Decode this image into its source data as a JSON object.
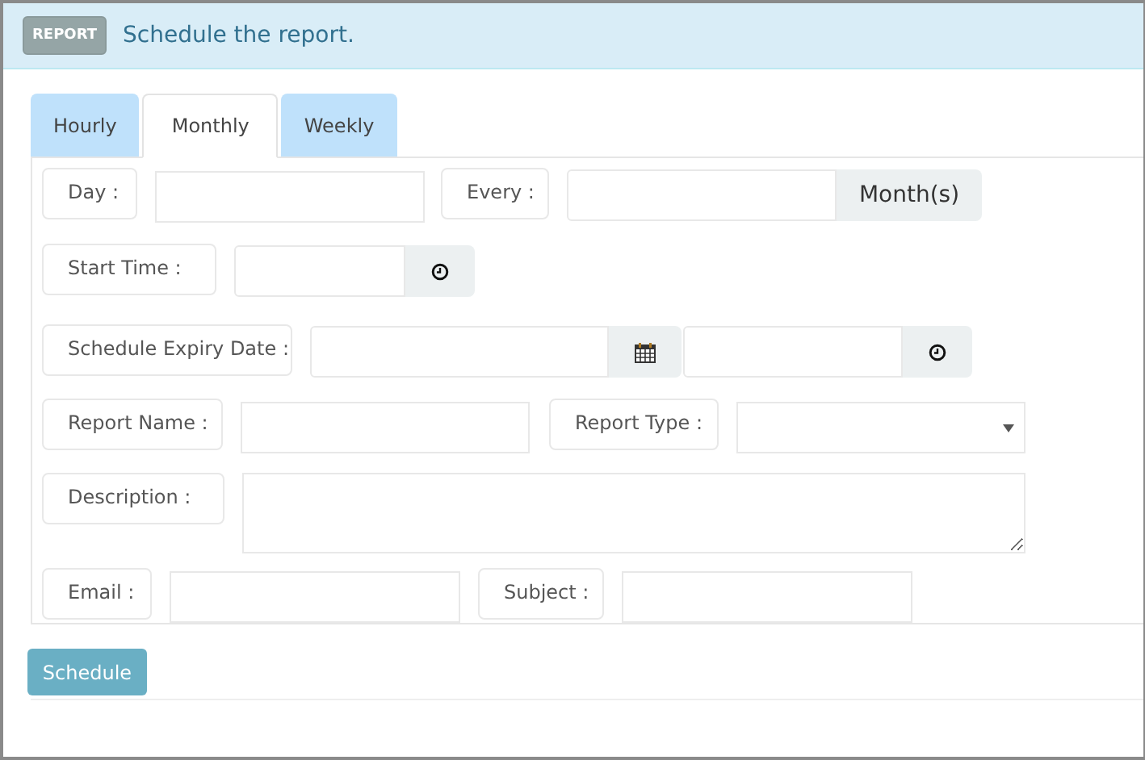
{
  "header": {
    "badge": "REPORT",
    "title": "Schedule the report."
  },
  "tabs": [
    {
      "label": "Hourly",
      "selected": false
    },
    {
      "label": "Monthly",
      "selected": true
    },
    {
      "label": "Weekly",
      "selected": false
    }
  ],
  "form_rows": [
    [
      {
        "kind": "label",
        "text": "Day :"
      },
      {
        "kind": "input"
      },
      {
        "kind": "label",
        "text": "Every :"
      },
      {
        "kind": "unit-input",
        "unit": "Month(s)"
      }
    ],
    [
      {
        "kind": "label",
        "text": "Start Time :"
      },
      {
        "kind": "time-input"
      }
    ],
    [
      {
        "kind": "label",
        "text": "Schedule Expiry Date :"
      },
      {
        "kind": "date-input"
      },
      {
        "kind": "time-input"
      }
    ],
    [
      {
        "kind": "label",
        "text": "Report Name :"
      },
      {
        "kind": "input"
      },
      {
        "kind": "label",
        "text": "Report Type :"
      },
      {
        "kind": "select"
      }
    ],
    [
      {
        "kind": "label",
        "text": "Description :"
      },
      {
        "kind": "textarea"
      }
    ],
    [
      {
        "kind": "label",
        "text": "Email :"
      },
      {
        "kind": "input"
      },
      {
        "kind": "label",
        "text": "Subject :"
      },
      {
        "kind": "input"
      }
    ]
  ],
  "submit_button": "Schedule"
}
